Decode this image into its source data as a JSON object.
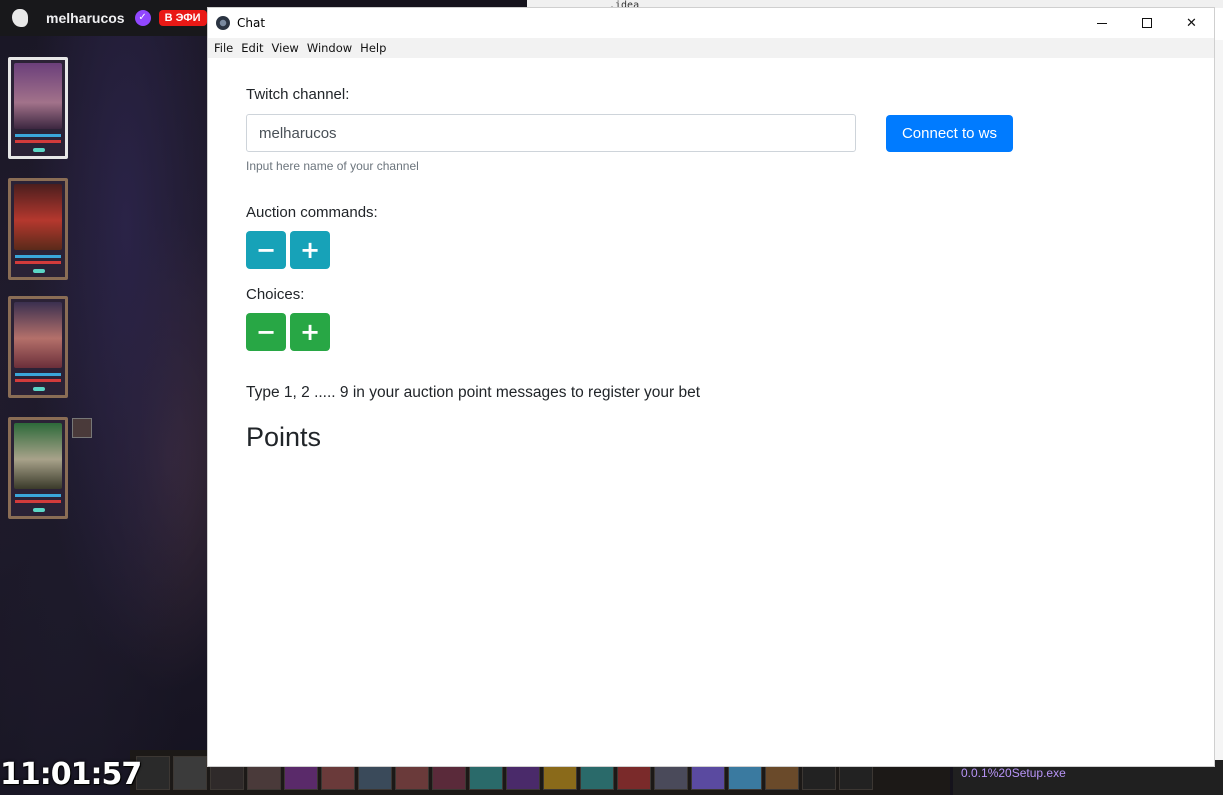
{
  "background": {
    "streamer_name": "melharucos",
    "live_badge": "В ЭФИ",
    "clock": "11:01:57",
    "download_file": "0.0.1%20Setup.exe",
    "ide_snippet": ".idea"
  },
  "window": {
    "title": "Chat",
    "controls": {
      "minimize_icon": "minimize-icon",
      "maximize_icon": "maximize-icon",
      "close_icon": "close-icon",
      "close_glyph": "✕"
    }
  },
  "menu": {
    "items": [
      "File",
      "Edit",
      "View",
      "Window",
      "Help"
    ]
  },
  "form": {
    "channel_label": "Twitch channel:",
    "channel_value": "melharucos",
    "channel_hint": "Input here name of your channel",
    "connect_label": "Connect to ws",
    "auction_label": "Auction commands:",
    "choices_label": "Choices:",
    "minus_glyph": "−",
    "plus_glyph": "+",
    "instruction": "Type 1, 2 ..... 9 in your auction point messages to register your bet",
    "points_heading": "Points"
  },
  "colors": {
    "primary": "#007bff",
    "info": "#17a2b8",
    "success": "#28a745"
  }
}
